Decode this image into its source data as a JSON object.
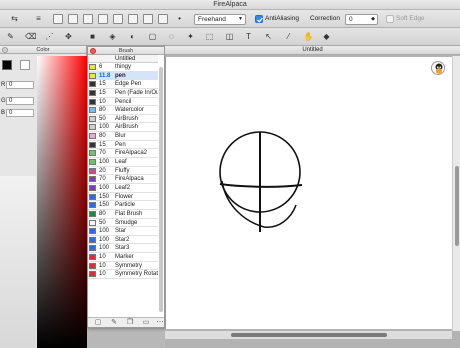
{
  "app": {
    "title": "FireAlpaca"
  },
  "toolbar": {
    "draw_mode": "Freehand",
    "antialiasing_label": "AntiAliasing",
    "antialiasing_checked": true,
    "correction_label": "Correction",
    "correction_value": "0",
    "soft_edge_label": "Soft Edge",
    "soft_edge_checked": false
  },
  "color_panel": {
    "title": "Color",
    "fg_color": "#000000",
    "bg_color": "#ffffff",
    "channels": [
      {
        "name": "R",
        "value": "0"
      },
      {
        "name": "G",
        "value": "0"
      },
      {
        "name": "B",
        "value": "0"
      }
    ]
  },
  "brush_panel": {
    "title": "Brush",
    "list_header": "Untitled",
    "brushes": [
      {
        "size": "6",
        "name": "thingy",
        "color": "#e8e83a",
        "selected": false
      },
      {
        "size": "11.8",
        "name": "pen",
        "color": "#e8e83a",
        "selected": true
      },
      {
        "size": "15",
        "name": "Edge Pen",
        "color": "#333333",
        "selected": false
      },
      {
        "size": "15",
        "name": "Pen (Fade In/Out)",
        "color": "#333333",
        "selected": false
      },
      {
        "size": "10",
        "name": "Pencil",
        "color": "#333333",
        "selected": false
      },
      {
        "size": "80",
        "name": "Watercolor",
        "color": "#6ec3f0",
        "selected": false
      },
      {
        "size": "50",
        "name": "AirBrush",
        "color": "#cfcfcf",
        "selected": false
      },
      {
        "size": "100",
        "name": "AirBrush",
        "color": "#cfcfcf",
        "selected": false
      },
      {
        "size": "80",
        "name": "Blur",
        "color": "#e8a8d8",
        "selected": false
      },
      {
        "size": "15",
        "name": "Pen",
        "color": "#333333",
        "selected": false
      },
      {
        "size": "70",
        "name": "FireAlpaca2",
        "color": "#6dc36d",
        "selected": false
      },
      {
        "size": "100",
        "name": "Leaf",
        "color": "#6dc36d",
        "selected": false
      },
      {
        "size": "20",
        "name": "Fluffy",
        "color": "#c94a8f",
        "selected": false
      },
      {
        "size": "70",
        "name": "FireAlpaca",
        "color": "#7b3fb0",
        "selected": false
      },
      {
        "size": "100",
        "name": "Leaf2",
        "color": "#7b3fb0",
        "selected": false
      },
      {
        "size": "150",
        "name": "Flower",
        "color": "#2e6cd8",
        "selected": false
      },
      {
        "size": "150",
        "name": "Particle",
        "color": "#2e6cd8",
        "selected": false
      },
      {
        "size": "80",
        "name": "Flat Brush",
        "color": "#1f8a3a",
        "selected": false
      },
      {
        "size": "50",
        "name": "Smudge",
        "color": "#f4f4f4",
        "selected": false
      },
      {
        "size": "100",
        "name": "Star",
        "color": "#2e6cd8",
        "selected": false
      },
      {
        "size": "100",
        "name": "Star2",
        "color": "#2e6cd8",
        "selected": false
      },
      {
        "size": "100",
        "name": "Star3",
        "color": "#2e6cd8",
        "selected": false
      },
      {
        "size": "10",
        "name": "Marker",
        "color": "#d63030",
        "selected": false
      },
      {
        "size": "10",
        "name": "Symmetry",
        "color": "#d63030",
        "selected": false
      },
      {
        "size": "10",
        "name": "Symmetry Rotation",
        "color": "#d63030",
        "selected": false
      }
    ]
  },
  "canvas": {
    "title": "Untitled"
  }
}
